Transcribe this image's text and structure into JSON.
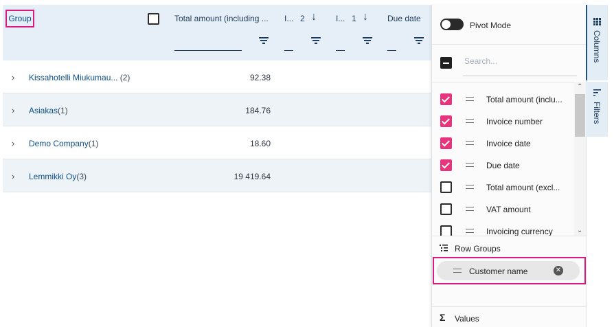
{
  "grid": {
    "group_header": "Group",
    "columns": [
      {
        "title": "Total amount (including ..."
      },
      {
        "title": "I...",
        "sort_index": "2"
      },
      {
        "title": "I...",
        "sort_index": "1"
      },
      {
        "title": "Due date"
      }
    ],
    "rows": [
      {
        "label": "Kissahotelli Miukumau...",
        "count": "(2)",
        "value": "92.38"
      },
      {
        "label": "Asiakas",
        "count": "(1)",
        "value": "184.76"
      },
      {
        "label": "Demo Company",
        "count": "(1)",
        "value": "18.60"
      },
      {
        "label": "Lemmikki Oy",
        "count": "(3)",
        "value": "19 419.64"
      }
    ]
  },
  "panel": {
    "pivot_mode_label": "Pivot Mode",
    "search_placeholder": "Search...",
    "columns": [
      {
        "label": "Total amount (inclu...",
        "checked": true
      },
      {
        "label": "Invoice number",
        "checked": true
      },
      {
        "label": "Invoice date",
        "checked": true
      },
      {
        "label": "Due date",
        "checked": true
      },
      {
        "label": "Total amount (excl...",
        "checked": false
      },
      {
        "label": "VAT amount",
        "checked": false
      },
      {
        "label": "Invoicing currency",
        "checked": false
      }
    ],
    "row_groups_label": "Row Groups",
    "row_group_chip": "Customer name",
    "values_label": "Values"
  },
  "side_tabs": {
    "columns": "Columns",
    "filters": "Filters"
  },
  "colors": {
    "highlight": "#d81b7f",
    "checkbox": "#e8347c",
    "link": "#0b4f8a"
  }
}
